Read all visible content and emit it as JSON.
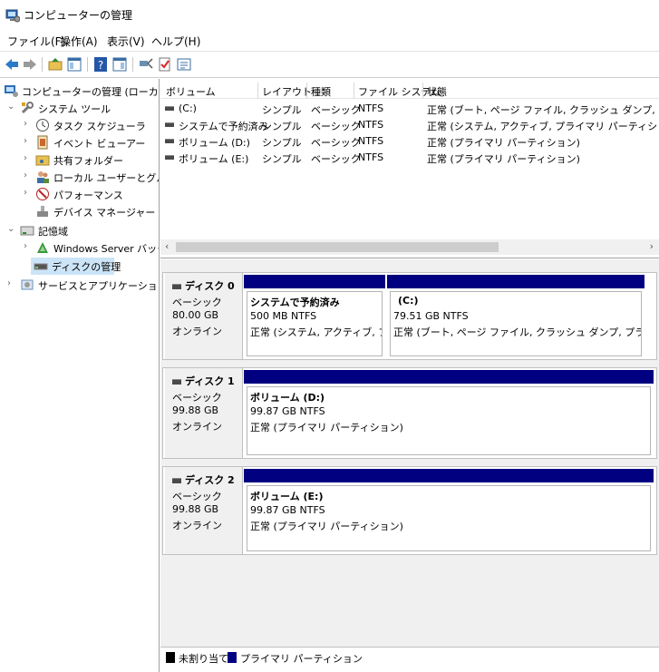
{
  "window": {
    "title": "コンピューターの管理"
  },
  "menu": [
    "ファイル(F)",
    "操作(A)",
    "表示(V)",
    "ヘルプ(H)"
  ],
  "tree": {
    "root": "コンピューターの管理 (ローカル)",
    "system_tools": "システム ツール",
    "task_scheduler": "タスク スケジューラ",
    "event_viewer": "イベント ビューアー",
    "shared_folders": "共有フォルダー",
    "local_users": "ローカル ユーザーとグループ",
    "performance": "パフォーマンス",
    "device_manager": "デバイス マネージャー",
    "storage": "記憶域",
    "windows_server_backup": "Windows Server バックア",
    "disk_management": "ディスクの管理",
    "services_apps": "サービスとアプリケーション"
  },
  "volume_list": {
    "columns": [
      "ボリューム",
      "レイアウト",
      "種類",
      "ファイル システム",
      "状態"
    ],
    "rows": [
      {
        "volume": "(C:)",
        "layout": "シンプル",
        "type": "ベーシック",
        "fs": "NTFS",
        "status": "正常 (ブート, ページ ファイル, クラッシュ ダンプ, プライマリ パ"
      },
      {
        "volume": "システムで予約済み",
        "layout": "シンプル",
        "type": "ベーシック",
        "fs": "NTFS",
        "status": "正常 (システム, アクティブ, プライマリ パーティション)"
      },
      {
        "volume": "ボリューム (D:)",
        "layout": "シンプル",
        "type": "ベーシック",
        "fs": "NTFS",
        "status": "正常 (プライマリ パーティション)"
      },
      {
        "volume": "ボリューム (E:)",
        "layout": "シンプル",
        "type": "ベーシック",
        "fs": "NTFS",
        "status": "正常 (プライマリ パーティション)"
      }
    ]
  },
  "disks": [
    {
      "name": "ディスク 0",
      "type": "ベーシック",
      "size": "80.00 GB",
      "state": "オンライン",
      "partitions": [
        {
          "title": "システムで予約済み",
          "size": "500 MB NTFS",
          "status": "正常 (システム, アクティブ, プライマ"
        },
        {
          "title": "(C:)",
          "size": "79.51 GB NTFS",
          "status": "正常 (ブート, ページ ファイル, クラッシュ ダンプ, プライマリ パーティシ"
        }
      ]
    },
    {
      "name": "ディスク 1",
      "type": "ベーシック",
      "size": "99.88 GB",
      "state": "オンライン",
      "partitions": [
        {
          "title": "ボリューム  (D:)",
          "size": "99.87 GB NTFS",
          "status": "正常 (プライマリ パーティション)"
        }
      ]
    },
    {
      "name": "ディスク 2",
      "type": "ベーシック",
      "size": "99.88 GB",
      "state": "オンライン",
      "partitions": [
        {
          "title": "ボリューム  (E:)",
          "size": "99.87 GB NTFS",
          "status": "正常 (プライマリ パーティション)"
        }
      ]
    }
  ],
  "legend": {
    "unallocated": "未割り当て",
    "primary": "プライマリ パーティション"
  },
  "colors": {
    "primary_partition": "#000080",
    "unallocated": "#000000",
    "selection": "#cce4f7"
  }
}
